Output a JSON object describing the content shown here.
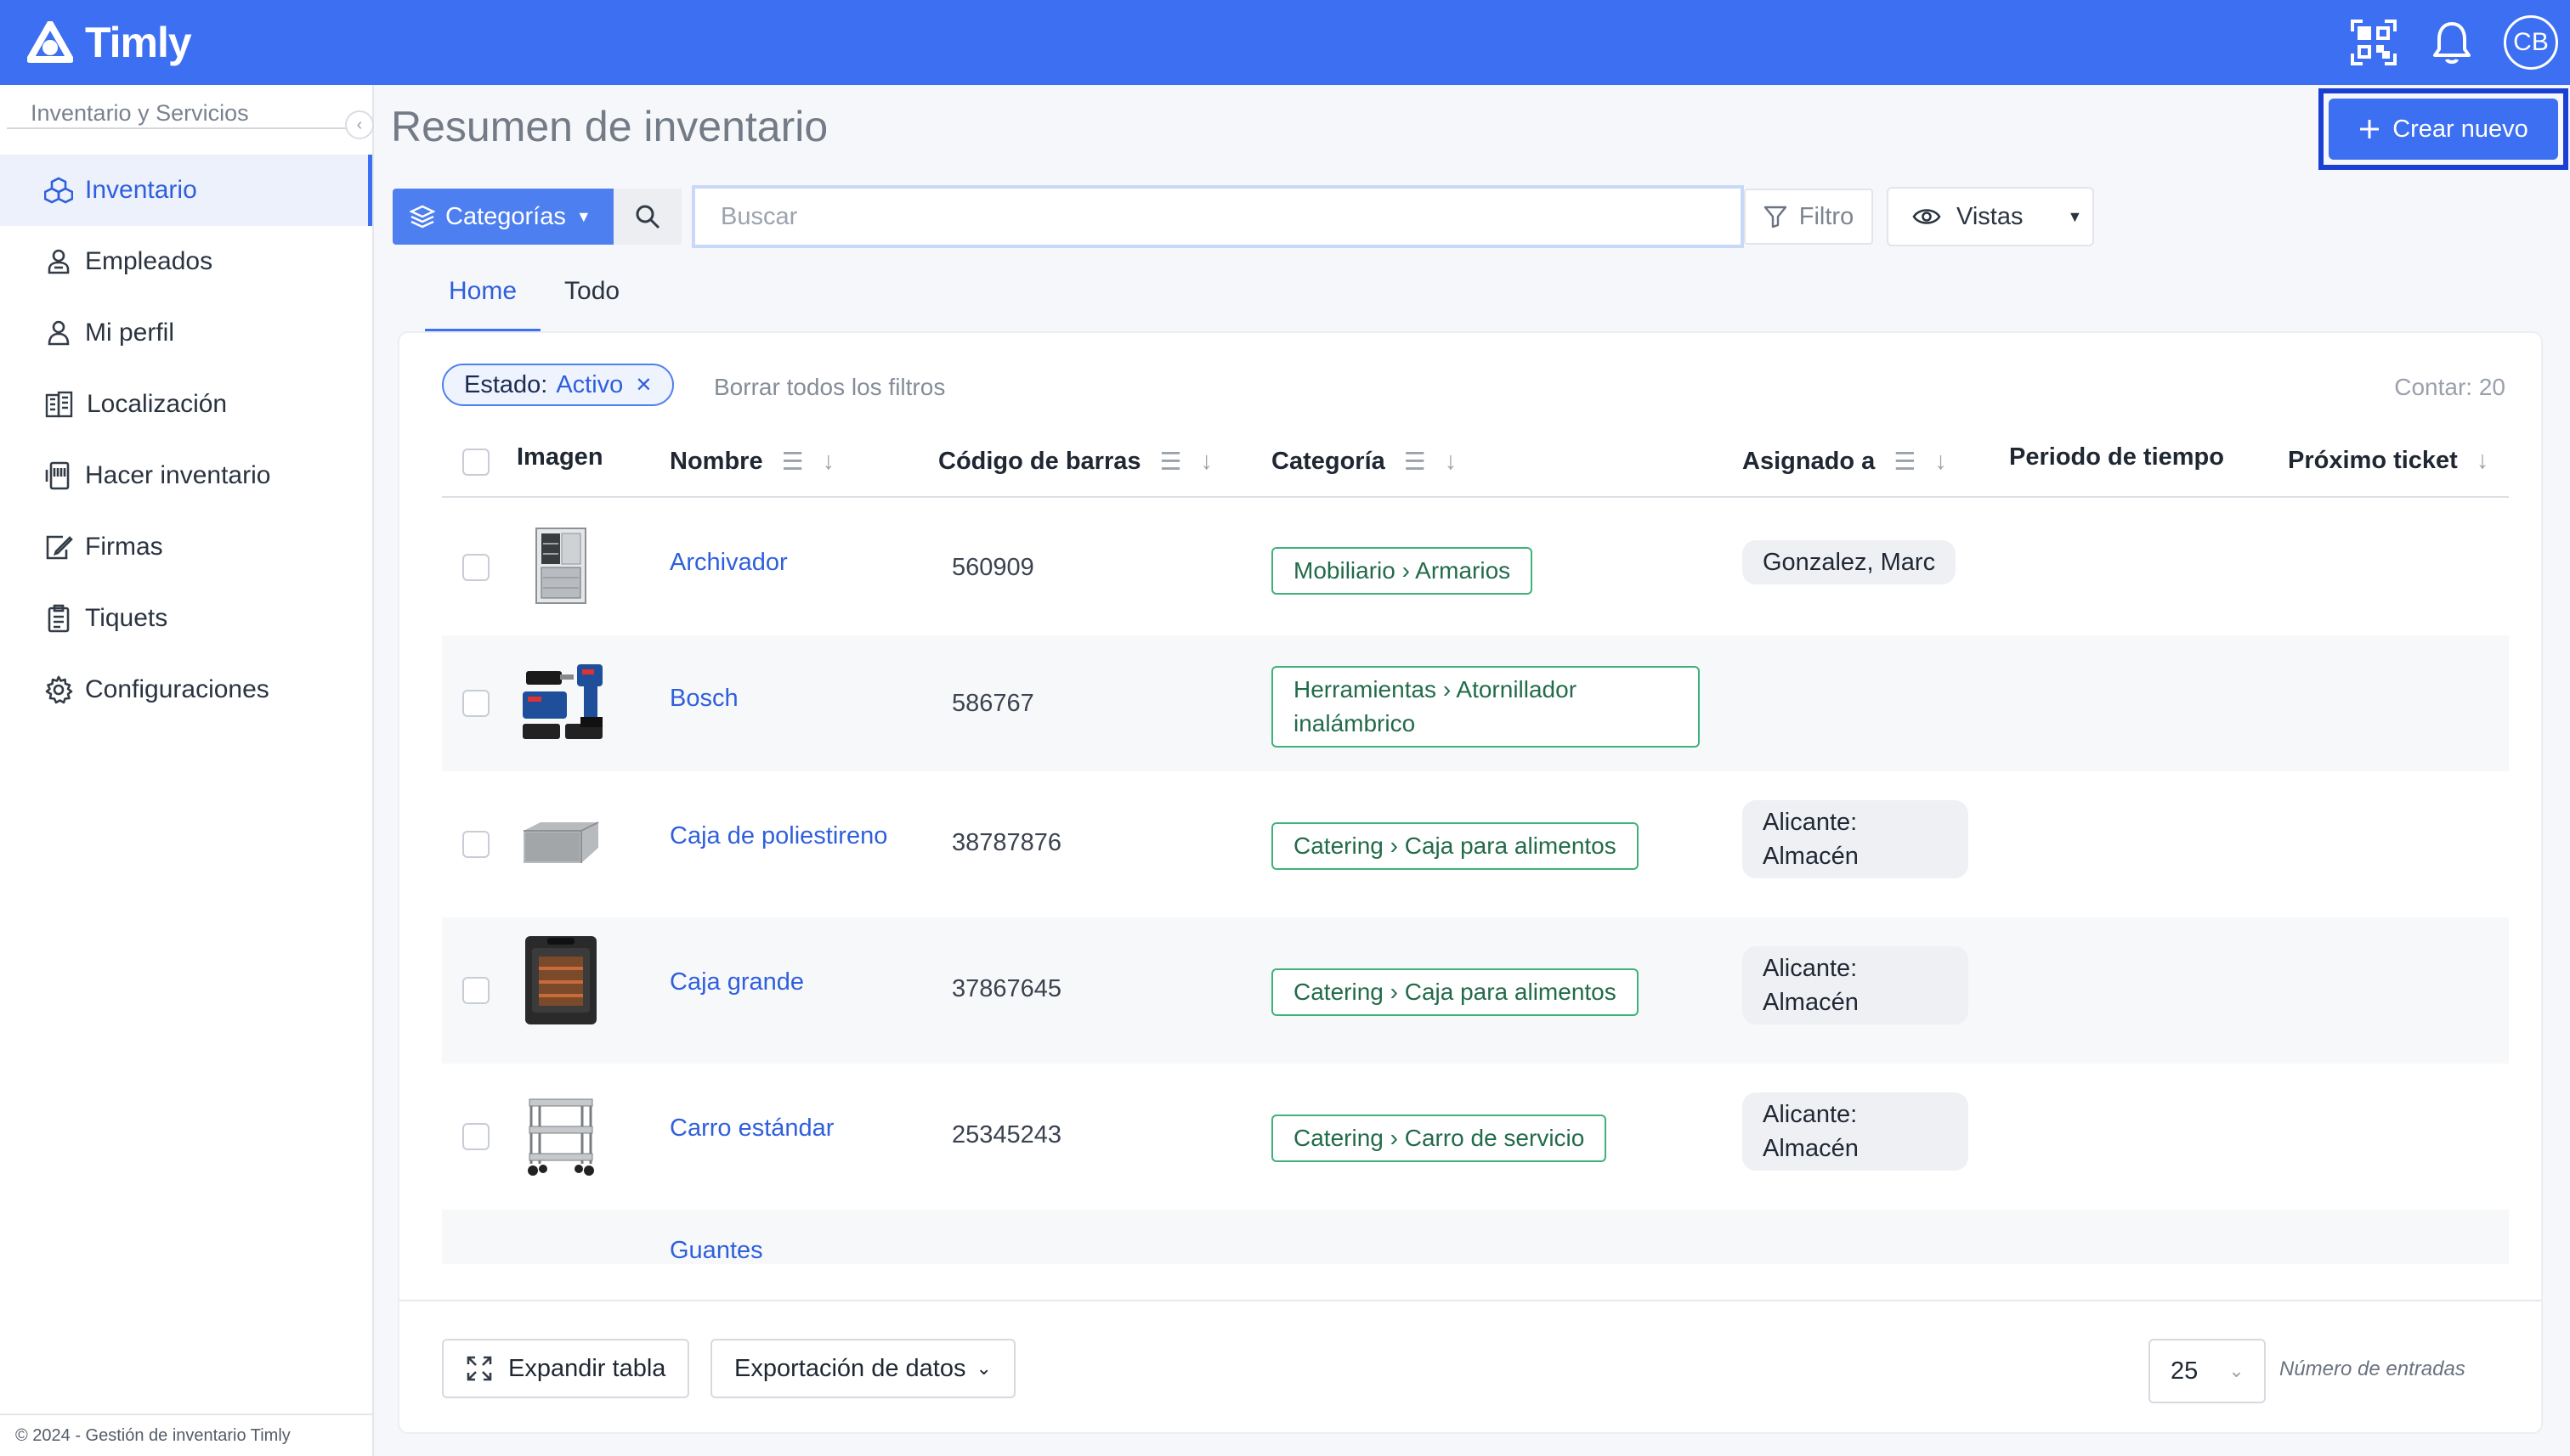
{
  "app": {
    "name": "Timly",
    "user_initials": "CB"
  },
  "sidebar": {
    "header": "Inventario y Servicios",
    "items": [
      {
        "label": "Inventario",
        "icon": "cubes-icon",
        "active": true
      },
      {
        "label": "Empleados",
        "icon": "employees-icon"
      },
      {
        "label": "Mi perfil",
        "icon": "user-icon"
      },
      {
        "label": "Localización",
        "icon": "building-icon"
      },
      {
        "label": "Hacer inventario",
        "icon": "scanner-icon"
      },
      {
        "label": "Firmas",
        "icon": "signature-icon"
      },
      {
        "label": "Tiquets",
        "icon": "clipboard-icon"
      },
      {
        "label": "Configuraciones",
        "icon": "gear-icon"
      }
    ],
    "footer": "© 2024 - Gestión de inventario Timly"
  },
  "page": {
    "title": "Resumen de inventario",
    "create_label": "Crear nuevo"
  },
  "toolbar": {
    "categories_label": "Categorías",
    "search_placeholder": "Buscar",
    "search_value": "",
    "filter_label": "Filtro",
    "views_label": "Vistas"
  },
  "tabs": [
    {
      "label": "Home",
      "active": true
    },
    {
      "label": "Todo",
      "active": false
    }
  ],
  "filters": {
    "chip_key": "Estado:",
    "chip_value": "Activo",
    "clear_all": "Borrar todos los filtros",
    "count": "Contar: 20"
  },
  "table": {
    "columns": {
      "image": "Imagen",
      "name": "Nombre",
      "barcode": "Código de barras",
      "category": "Categoría",
      "assigned": "Asignado a",
      "period": "Periodo de tiempo",
      "next_ticket": "Próximo ticket"
    },
    "rows": [
      {
        "name": "Archivador",
        "barcode": "560909",
        "category": "Mobiliario › Armarios",
        "assigned": "Gonzalez, Marc",
        "image": "cabinet-image"
      },
      {
        "name": "Bosch",
        "barcode": "586767",
        "category": "Herramientas › Atornillador inalámbrico",
        "assigned": "",
        "image": "drill-image"
      },
      {
        "name": "Caja de poliestireno",
        "barcode": "38787876",
        "category": "Catering › Caja para alimentos",
        "assigned": "Alicante: Almacén",
        "image": "styrofoam-box-image"
      },
      {
        "name": "Caja grande",
        "barcode": "37867645",
        "category": "Catering › Caja para alimentos",
        "assigned": "Alicante: Almacén",
        "image": "food-box-image"
      },
      {
        "name": "Carro estándar",
        "barcode": "25345243",
        "category": "Catering › Carro de servicio",
        "assigned": "Alicante: Almacén",
        "image": "cart-image"
      },
      {
        "name": "Guantes",
        "barcode": "",
        "category": "",
        "assigned": "",
        "image": "gloves-image"
      }
    ]
  },
  "footer": {
    "expand_label": "Expandir tabla",
    "export_label": "Exportación de datos",
    "per_page": "25",
    "per_page_label": "Número de entradas"
  },
  "colors": {
    "brand": "#3d6ff2",
    "link": "#2f5fdc",
    "category_border": "#3fb27a"
  }
}
